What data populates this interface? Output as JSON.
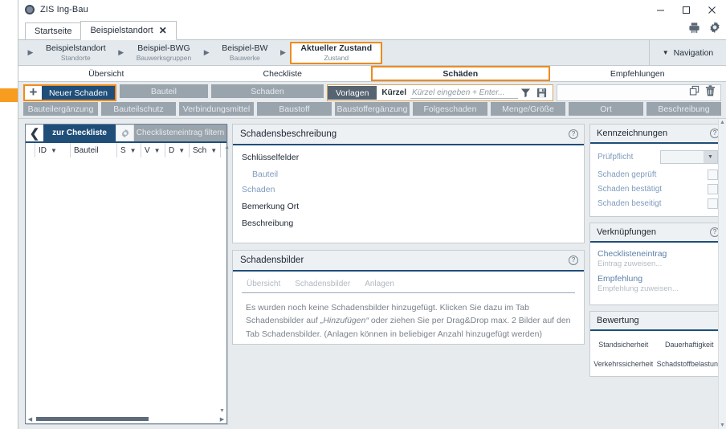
{
  "window": {
    "app_title": "ZIS Ing-Bau",
    "controls": {
      "minimize": "minimize-icon",
      "maximize": "maximize-icon",
      "close": "close-icon"
    }
  },
  "tabs": [
    {
      "label": "Startseite",
      "active": false,
      "closable": false
    },
    {
      "label": "Beispielstandort",
      "active": true,
      "closable": true,
      "close_label": "✕"
    }
  ],
  "header_icons": {
    "print": "print-icon",
    "settings": "gear-icon"
  },
  "breadcrumb": {
    "items": [
      {
        "main": "Beispielstandort",
        "sub": "Standorte",
        "active": false
      },
      {
        "main": "Beispiel-BWG",
        "sub": "Bauwerksgruppen",
        "active": false
      },
      {
        "main": "Beispiel-BW",
        "sub": "Bauwerke",
        "active": false
      },
      {
        "main": "Aktueller Zustand",
        "sub": "Zustand",
        "active": true
      }
    ],
    "arrow": "▶",
    "navigation_label": "Navigation",
    "navigation_caret": "▼"
  },
  "section_tabs": [
    {
      "label": "Übersicht",
      "active": false
    },
    {
      "label": "Checkliste",
      "active": false
    },
    {
      "label": "Schäden",
      "active": true
    },
    {
      "label": "Empfehlungen",
      "active": false
    }
  ],
  "toolbar": {
    "plus_label": "+",
    "new_damage_label": "Neuer Schaden",
    "row1_buttons": [
      "Bauteil",
      "Schaden"
    ],
    "templates_label": "Vorlagen",
    "kurzel_label": "Kürzel",
    "kurzel_value": "",
    "kurzel_placeholder": "Kürzel eingeben + Enter...",
    "filter_icon": "funnel-icon",
    "save_icon": "save-disk-icon",
    "copy_icon": "copy-icon",
    "delete_icon": "trash-icon",
    "row2_buttons": [
      "Bauteilergänzung",
      "Bauteilschutz",
      "Verbindungsmittel",
      "Baustoff",
      "Baustoffergänzung",
      "Folgeschaden",
      "Menge/Größe",
      "Ort",
      "Beschreibung"
    ]
  },
  "left_panel": {
    "back_icon": "chevron-left-icon",
    "title": "zur Checkliste",
    "gear_icon": "gear-icon",
    "filter_button": "Checklisteneintrag filtern",
    "columns": [
      {
        "label": "",
        "sortable": false
      },
      {
        "label": "ID",
        "sortable": true
      },
      {
        "label": "Bauteil",
        "sortable": false
      },
      {
        "label": "S",
        "sortable": true
      },
      {
        "label": "V",
        "sortable": true
      },
      {
        "label": "D",
        "sortable": true
      },
      {
        "label": "Sch",
        "sortable": true
      }
    ],
    "sort_glyph": "▼",
    "rows": [],
    "scroll_up": "▲",
    "scroll_down": "▼",
    "scroll_left": "◀",
    "scroll_right": "▶"
  },
  "damage_description": {
    "title": "Schadensbeschreibung",
    "help": "?",
    "fields": [
      {
        "label": "Schlüsselfelder",
        "style": "header"
      },
      {
        "label": "Bauteil",
        "style": "sub"
      },
      {
        "label": "Schaden",
        "style": "link"
      },
      {
        "label": "Bemerkung Ort",
        "style": "header"
      },
      {
        "label": "Beschreibung",
        "style": "header"
      }
    ]
  },
  "damage_images": {
    "title": "Schadensbilder",
    "help": "?",
    "tabs": [
      "Übersicht",
      "Schadensbilder",
      "Anlagen"
    ],
    "empty_note_line1_a": "Es wurden noch keine Schadensbilder hinzugefügt. Klicken Sie dazu im Tab Schadensbilder auf",
    "empty_note_line2_quote": "„Hinzufügen“",
    "empty_note_line2_b": " oder ziehen Sie per Drag&Drop max. 2 Bilder auf den Tab Schadensbilder.",
    "empty_note_line3": "(Anlagen können in beliebiger Anzahl hinzugefügt werden)"
  },
  "markings": {
    "title": "Kennzeichnungen",
    "help": "?",
    "select_label": "Prüfpflicht",
    "select_value": "",
    "select_caret": "▼",
    "checkboxes": [
      {
        "label": "Schaden geprüft",
        "checked": false
      },
      {
        "label": "Schaden bestätigt",
        "checked": false
      },
      {
        "label": "Schaden beseitigt",
        "checked": false
      }
    ]
  },
  "links": {
    "title": "Verknüpfungen",
    "help": "?",
    "entries": [
      {
        "label": "Checklisteneintrag",
        "sub": "Eintrag zuweisen..."
      },
      {
        "label": "Empfehlung",
        "sub": "Empfehlung zuweisen..."
      }
    ]
  },
  "rating": {
    "title": "Bewertung",
    "help": "?",
    "cells": [
      "Standsicherheit",
      "Dauerhaftigkeit",
      "Verkehrssicherheit",
      "Schadstoffbelastung"
    ]
  },
  "colors": {
    "accent_orange": "#f08a1c",
    "primary_blue": "#1f4e79",
    "grey_button": "#9aa4ad",
    "panel_bg": "#e7ebed",
    "edge_marker": "#f89c20"
  }
}
